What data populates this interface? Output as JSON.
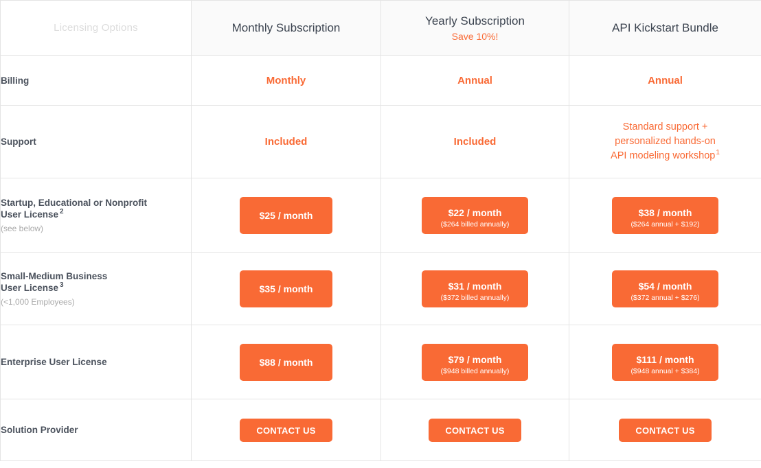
{
  "table": {
    "columns": [
      {
        "id": "licensing-options",
        "title": "Licensing Options",
        "subtitle": ""
      },
      {
        "id": "monthly-subscription",
        "title": "Monthly Subscription",
        "subtitle": ""
      },
      {
        "id": "yearly-subscription",
        "title": "Yearly Subscription",
        "subtitle": "Save 10%!"
      },
      {
        "id": "api-kickstart-bundle",
        "title": "API Kickstart Bundle",
        "subtitle": ""
      }
    ],
    "rows": {
      "billing": {
        "label": "Billing",
        "monthly": "Monthly",
        "yearly": "Annual",
        "bundle": "Annual"
      },
      "support": {
        "label": "Support",
        "monthly": "Included",
        "yearly": "Included",
        "bundle_line1": "Standard support +",
        "bundle_line2": "personalized hands-on",
        "bundle_line3": "API modeling workshop",
        "bundle_footnote": "1"
      },
      "startup": {
        "label": "Startup, Educational or Nonprofit",
        "label_line2": "User License",
        "footnote": "2",
        "note": "(see below)",
        "monthly_price": "$25",
        "monthly_per": " / month",
        "yearly_price": "$22",
        "yearly_per": " / month",
        "yearly_sub": "($264 billed annually)",
        "bundle_price": "$38",
        "bundle_per": " / month",
        "bundle_sub": "($264 annual + $192)"
      },
      "smb": {
        "label": "Small-Medium Business",
        "label_line2": "User License",
        "footnote": "3",
        "note": "(<1,000 Employees)",
        "monthly_price": "$35",
        "monthly_per": " / month",
        "yearly_price": "$31",
        "yearly_per": " / month",
        "yearly_sub": "($372 billed annually)",
        "bundle_price": "$54",
        "bundle_per": " / month",
        "bundle_sub": "($372 annual + $276)"
      },
      "enterprise": {
        "label": "Enterprise User License",
        "monthly_price": "$88",
        "monthly_per": " / month",
        "yearly_price": "$79",
        "yearly_per": " / month",
        "yearly_sub": "($948 billed annually)",
        "bundle_price": "$111",
        "bundle_per": " / month",
        "bundle_sub": "($948 annual + $384)"
      },
      "solution_provider": {
        "label": "Solution Provider",
        "monthly_cta": "CONTACT US",
        "yearly_cta": "CONTACT US",
        "bundle_cta": "CONTACT US"
      }
    }
  },
  "colors": {
    "accent": "#f96a35",
    "label_text": "#4a515c",
    "header_title": "#3c4450",
    "header_placeholder": "#dcdcdc",
    "muted": "#a9a9a9",
    "border": "#e4e4e4",
    "header_bg": "#fafafa"
  }
}
